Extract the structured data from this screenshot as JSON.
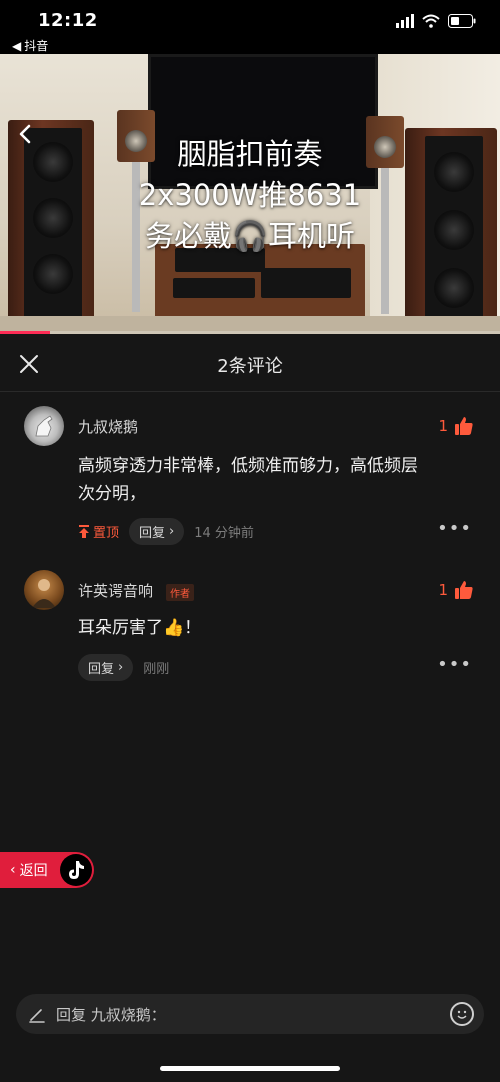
{
  "status": {
    "time": "12:12",
    "back_app": "抖音"
  },
  "video": {
    "title_lines": [
      "胭脂扣前奏",
      "2x300W推8631",
      "务必戴🎧耳机听"
    ],
    "progress": 0.1
  },
  "comments_panel": {
    "title": "2条评论",
    "comments": [
      {
        "username": "九叔烧鹅",
        "likes": "1",
        "text_lines": [
          "高频穿透力非常棒，低频准而够力，高低频层",
          "次分明，"
        ],
        "pinned_label": "置顶",
        "reply_label": "回复",
        "time": "14 分钟前"
      },
      {
        "username": "许英谔音响",
        "author_badge": "作者",
        "likes": "1",
        "text": "耳朵厉害了👍！",
        "reply_label": "回复",
        "time": "刚刚"
      }
    ]
  },
  "return_button": {
    "label": "返回"
  },
  "input": {
    "placeholder": "回复 九叔烧鹅："
  },
  "colors": {
    "accent": "#fe2c55",
    "like": "#fe5a3c",
    "sheet_bg": "#161616"
  }
}
